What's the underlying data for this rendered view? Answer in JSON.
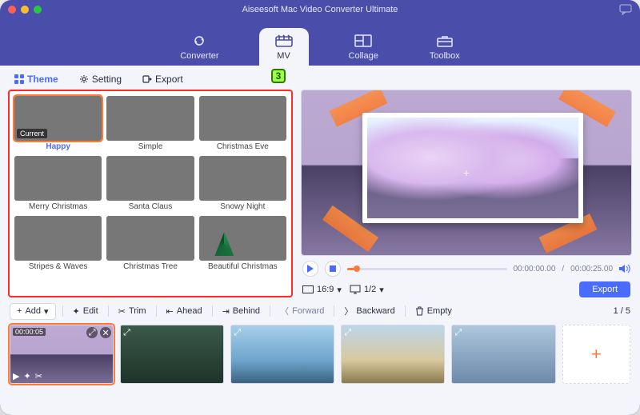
{
  "window": {
    "title": "Aiseesoft Mac Video Converter Ultimate"
  },
  "nav": {
    "converter": "Converter",
    "mv": "MV",
    "collage": "Collage",
    "toolbox": "Toolbox"
  },
  "subtabs": {
    "theme": "Theme",
    "setting": "Setting",
    "export": "Export"
  },
  "step_badge": "3",
  "themes": [
    {
      "label": "Happy",
      "current_tag": "Current",
      "selected": true,
      "thumb": "th-happy"
    },
    {
      "label": "Simple",
      "thumb": "th-simple"
    },
    {
      "label": "Christmas Eve",
      "thumb": "th-xmas-eve"
    },
    {
      "label": "Merry Christmas",
      "thumb": "th-merry"
    },
    {
      "label": "Santa Claus",
      "thumb": "th-santa"
    },
    {
      "label": "Snowy Night",
      "thumb": "th-snowy"
    },
    {
      "label": "Stripes & Waves",
      "thumb": "th-stripes"
    },
    {
      "label": "Christmas Tree",
      "thumb": "th-tree"
    },
    {
      "label": "Beautiful Christmas",
      "thumb": "th-beauty"
    }
  ],
  "player": {
    "time_current": "00:00:00.00",
    "time_total": "00:00:25.00"
  },
  "ratio": {
    "label": "16:9",
    "count": "1/2"
  },
  "export_btn": "Export",
  "toolbar": {
    "add": "Add",
    "edit": "Edit",
    "trim": "Trim",
    "ahead": "Ahead",
    "behind": "Behind",
    "forward": "Forward",
    "backward": "Backward",
    "empty": "Empty",
    "pager": "1 / 5"
  },
  "clips": [
    {
      "duration": "00:00:05",
      "selected": true,
      "thumb": "c1"
    },
    {
      "thumb": "c2"
    },
    {
      "thumb": "c3"
    },
    {
      "thumb": "c4"
    },
    {
      "thumb": "c5"
    }
  ]
}
